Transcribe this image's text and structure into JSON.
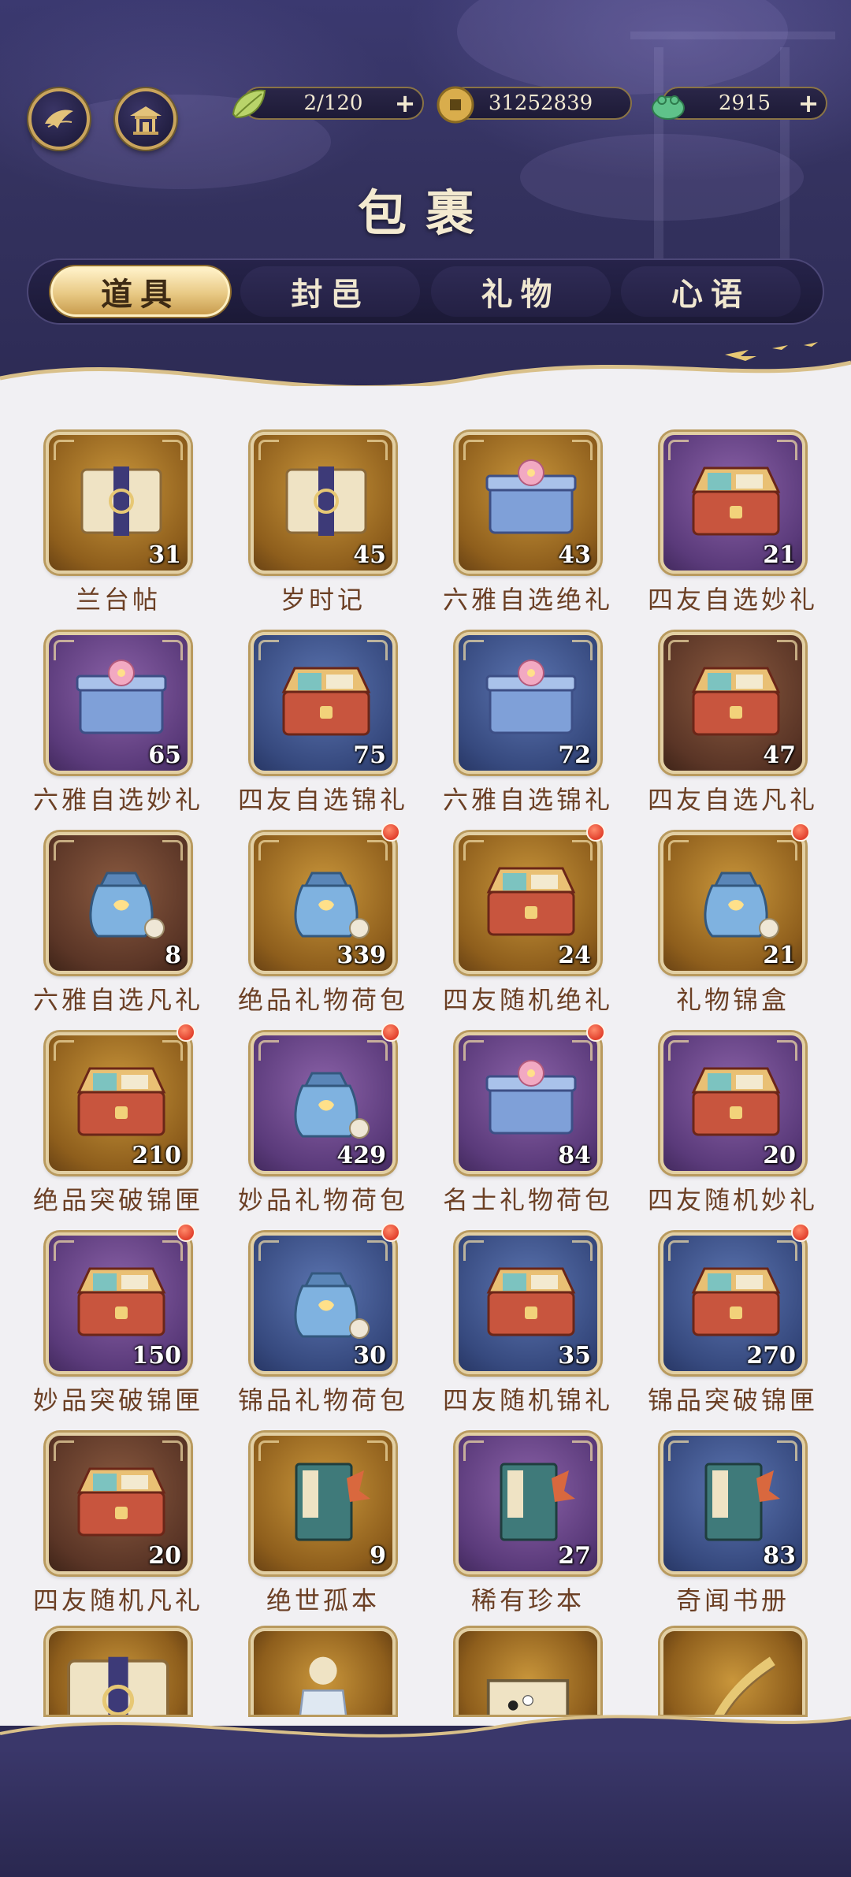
{
  "header": {
    "title": "包裹",
    "left_buttons": [
      {
        "name": "leaf-emblem-button",
        "icon": "leaf-emblem-icon"
      },
      {
        "name": "pavilion-button",
        "icon": "pavilion-icon"
      }
    ],
    "resources": [
      {
        "id": "stamina",
        "icon": "green-leaf-icon",
        "value": "2/120",
        "has_plus": true
      },
      {
        "id": "coins",
        "icon": "gold-coin-icon",
        "value": "31252839",
        "has_plus": false
      },
      {
        "id": "jade",
        "icon": "jade-toad-icon",
        "value": "2915",
        "has_plus": true
      }
    ]
  },
  "tabs": [
    {
      "label": "道具",
      "active": true
    },
    {
      "label": "封邑",
      "active": false
    },
    {
      "label": "礼物",
      "active": false
    },
    {
      "label": "心语",
      "active": false
    }
  ],
  "items": [
    {
      "name": "兰台帖",
      "count": "31",
      "frame": "gold",
      "dot": false,
      "art": "scroll"
    },
    {
      "name": "岁时记",
      "count": "45",
      "frame": "gold",
      "dot": false,
      "art": "scroll"
    },
    {
      "name": "六雅自选绝礼",
      "count": "43",
      "frame": "gold",
      "dot": false,
      "art": "box"
    },
    {
      "name": "四友自选妙礼",
      "count": "21",
      "frame": "purple",
      "dot": false,
      "art": "chest"
    },
    {
      "name": "六雅自选妙礼",
      "count": "65",
      "frame": "purple",
      "dot": false,
      "art": "box"
    },
    {
      "name": "四友自选锦礼",
      "count": "75",
      "frame": "blue",
      "dot": false,
      "art": "chest"
    },
    {
      "name": "六雅自选锦礼",
      "count": "72",
      "frame": "blue",
      "dot": false,
      "art": "box"
    },
    {
      "name": "四友自选凡礼",
      "count": "47",
      "frame": "brown",
      "dot": false,
      "art": "chest"
    },
    {
      "name": "六雅自选凡礼",
      "count": "8",
      "frame": "brown",
      "dot": false,
      "art": "pouch"
    },
    {
      "name": "绝品礼物荷包",
      "count": "339",
      "frame": "gold",
      "dot": true,
      "art": "pouch"
    },
    {
      "name": "四友随机绝礼",
      "count": "24",
      "frame": "gold",
      "dot": true,
      "art": "chest"
    },
    {
      "name": "礼物锦盒",
      "count": "21",
      "frame": "gold",
      "dot": true,
      "art": "pouch"
    },
    {
      "name": "绝品突破锦匣",
      "count": "210",
      "frame": "gold",
      "dot": true,
      "art": "chest"
    },
    {
      "name": "妙品礼物荷包",
      "count": "429",
      "frame": "purple",
      "dot": true,
      "art": "pouch"
    },
    {
      "name": "名士礼物荷包",
      "count": "84",
      "frame": "purple",
      "dot": true,
      "art": "box"
    },
    {
      "name": "四友随机妙礼",
      "count": "20",
      "frame": "purple",
      "dot": false,
      "art": "chest"
    },
    {
      "name": "妙品突破锦匣",
      "count": "150",
      "frame": "purple",
      "dot": true,
      "art": "chest"
    },
    {
      "name": "锦品礼物荷包",
      "count": "30",
      "frame": "blue",
      "dot": true,
      "art": "pouch"
    },
    {
      "name": "四友随机锦礼",
      "count": "35",
      "frame": "blue",
      "dot": false,
      "art": "chest"
    },
    {
      "name": "锦品突破锦匣",
      "count": "270",
      "frame": "blue",
      "dot": true,
      "art": "chest"
    },
    {
      "name": "四友随机凡礼",
      "count": "20",
      "frame": "brown",
      "dot": false,
      "art": "chest"
    },
    {
      "name": "绝世孤本",
      "count": "9",
      "frame": "gold",
      "dot": false,
      "art": "book"
    },
    {
      "name": "稀有珍本",
      "count": "27",
      "frame": "purple",
      "dot": false,
      "art": "book"
    },
    {
      "name": "奇闻书册",
      "count": "83",
      "frame": "blue",
      "dot": false,
      "art": "book"
    }
  ],
  "partial_row": [
    {
      "frame": "gold",
      "art": "scroll"
    },
    {
      "frame": "gold",
      "art": "figure"
    },
    {
      "frame": "gold",
      "art": "board"
    },
    {
      "frame": "gold",
      "art": "instrument"
    }
  ],
  "colors": {
    "header_bg": "#34325f",
    "panel_bg": "#f1f0f3",
    "label_text": "#6b3f24",
    "tab_active": "#e8c984",
    "frame_border": "#b99a5e",
    "dot": "#e2412d"
  }
}
